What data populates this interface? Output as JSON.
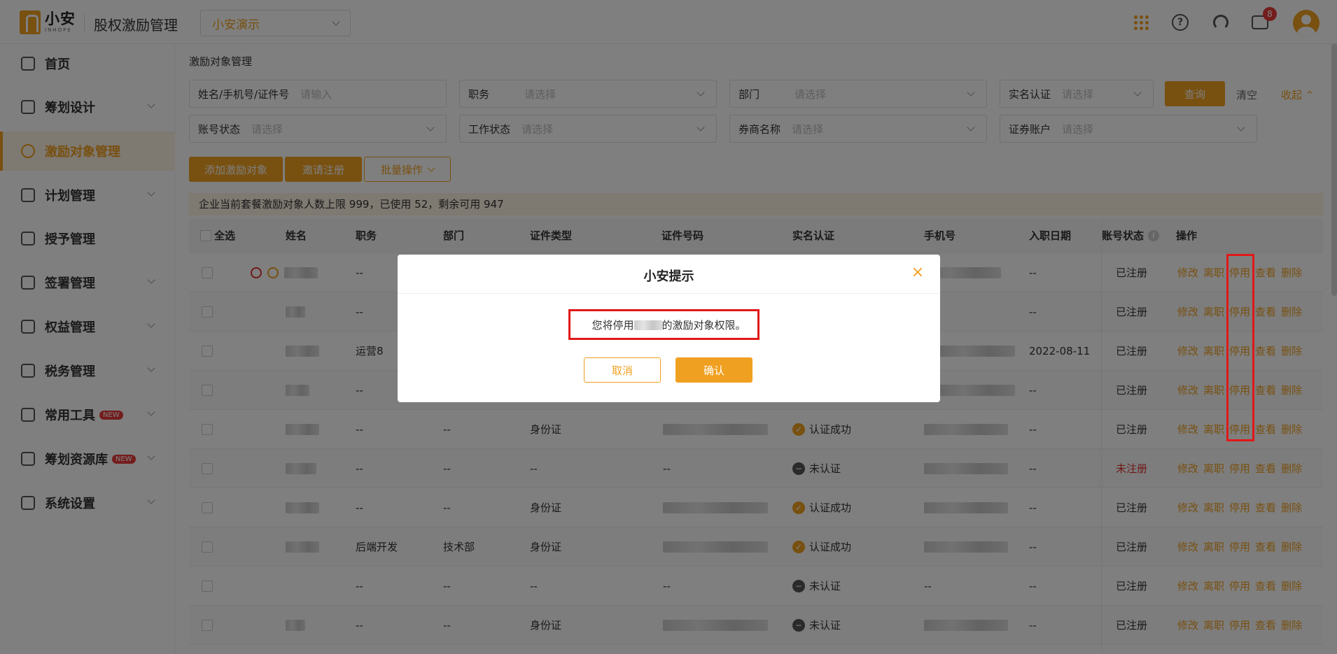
{
  "app": {
    "logo_cn": "小安",
    "logo_en": "INHOPE",
    "title": "股权激励管理",
    "tenant": "小安演示",
    "badge_count": "8"
  },
  "sidebar": {
    "items": [
      {
        "label": "首页",
        "icon": "home-icon"
      },
      {
        "label": "筹划设计",
        "icon": "edit-icon"
      },
      {
        "label": "激励对象管理",
        "icon": "users-icon"
      },
      {
        "label": "计划管理",
        "icon": "grid-icon"
      },
      {
        "label": "授予管理",
        "icon": "document-icon"
      },
      {
        "label": "签署管理",
        "icon": "pen-icon"
      },
      {
        "label": "权益管理",
        "icon": "shield-icon"
      },
      {
        "label": "税务管理",
        "icon": "tax-icon"
      },
      {
        "label": "常用工具",
        "icon": "toolbox-icon",
        "tag": "NEW"
      },
      {
        "label": "筹划资源库",
        "icon": "layers-icon",
        "tag": "NEW"
      },
      {
        "label": "系统设置",
        "icon": "gear-icon"
      }
    ]
  },
  "page": {
    "breadcrumb": "激励对象管理"
  },
  "filters": {
    "name": {
      "label": "姓名/手机号/证件号",
      "placeholder": "请输入"
    },
    "position": {
      "label": "职务",
      "placeholder": "请选择"
    },
    "department": {
      "label": "部门",
      "placeholder": "请选择"
    },
    "realname": {
      "label": "实名认证",
      "placeholder": "请选择"
    },
    "account_status": {
      "label": "账号状态",
      "placeholder": "请选择"
    },
    "work_status": {
      "label": "工作状态",
      "placeholder": "请选择"
    },
    "broker": {
      "label": "券商名称",
      "placeholder": "请选择"
    },
    "securities": {
      "label": "证券账户",
      "placeholder": "请选择"
    },
    "query": "查询",
    "clear": "清空",
    "collapse": "收起"
  },
  "actions": {
    "add": "添加激励对象",
    "invite": "邀请注册",
    "batch": "批量操作"
  },
  "notice": "企业当前套餐激励对象人数上限 999，已使用 52，剩余可用 947",
  "table": {
    "columns": {
      "select_all": "全选",
      "name": "姓名",
      "position": "职务",
      "department": "部门",
      "id_type": "证件类型",
      "id_no": "证件号码",
      "verify": "实名认证",
      "phone": "手机号",
      "hire_date": "入职日期",
      "account": "账号状态",
      "ops": "操作"
    },
    "ops": [
      "修改",
      "离职",
      "停用",
      "查看",
      "删除"
    ],
    "rows": [
      {
        "position": "--",
        "department": "",
        "id_type": "",
        "verify": "",
        "hire_date": "--",
        "account": "已注册"
      },
      {
        "position": "--",
        "department": "",
        "id_type": "",
        "verify": "",
        "hire_date": "--",
        "account": "已注册"
      },
      {
        "position": "运营8",
        "department": "",
        "id_type": "",
        "verify": "",
        "hire_date": "2022-08-11",
        "account": "已注册"
      },
      {
        "position": "--",
        "department": "",
        "id_type": "",
        "verify": "",
        "hire_date": "--",
        "account": "已注册"
      },
      {
        "position": "--",
        "department": "--",
        "id_type": "身份证",
        "verify": "认证成功",
        "hire_date": "--",
        "account": "已注册"
      },
      {
        "position": "--",
        "department": "--",
        "id_type": "--",
        "id_no": "--",
        "verify": "未认证",
        "hire_date": "--",
        "account": "未注册"
      },
      {
        "position": "--",
        "department": "--",
        "id_type": "身份证",
        "verify": "认证成功",
        "hire_date": "--",
        "account": "已注册"
      },
      {
        "position": "后端开发",
        "department": "技术部",
        "id_type": "身份证",
        "verify": "认证成功",
        "hire_date": "--",
        "account": "已注册"
      },
      {
        "position": "--",
        "department": "--",
        "id_type": "--",
        "id_no": "--",
        "verify": "未认证",
        "phone": "--",
        "hire_date": "--",
        "account": "已注册"
      },
      {
        "position": "--",
        "department": "--",
        "id_type": "身份证",
        "verify": "未认证",
        "hire_date": "--",
        "account": "已注册"
      }
    ]
  },
  "dialog": {
    "title": "小安提示",
    "message_prefix": "您将停用",
    "message_suffix": "的激励对象权限。",
    "cancel": "取消",
    "confirm": "确认"
  },
  "colors": {
    "accent": "#f0a020",
    "danger": "#e03030",
    "highlight": "#e01818"
  }
}
